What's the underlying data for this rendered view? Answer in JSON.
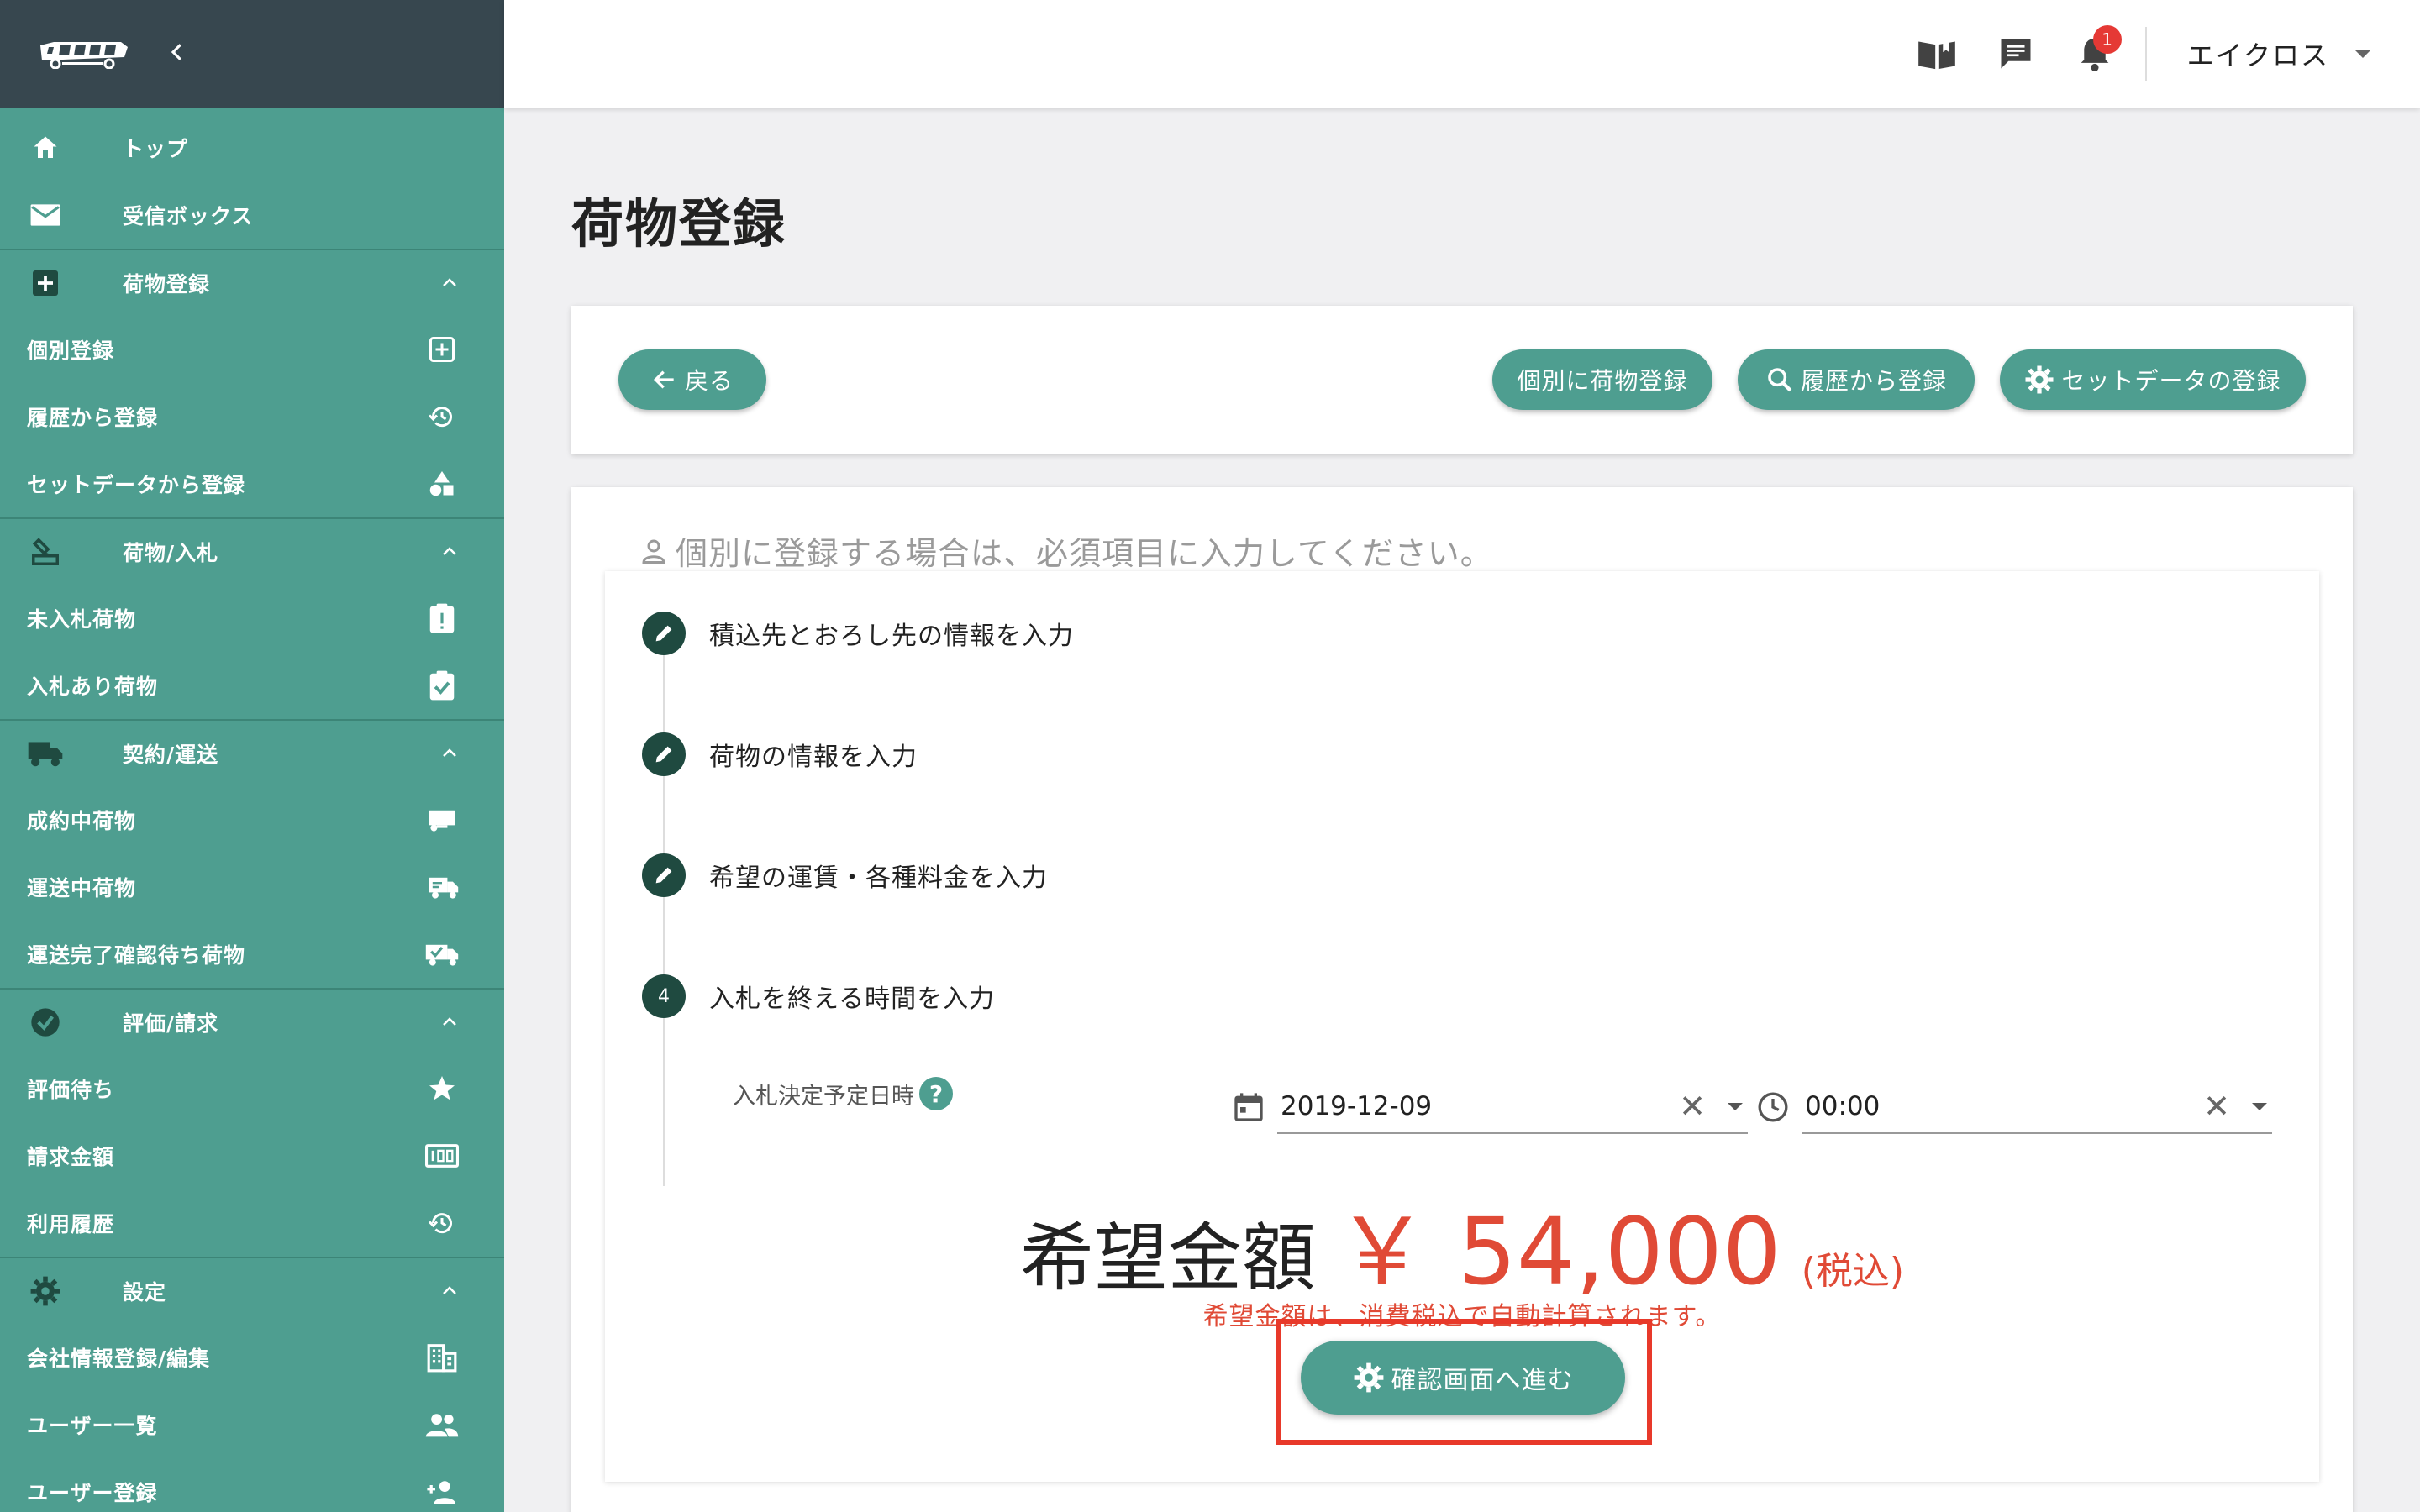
{
  "sidebar": {
    "items": {
      "top": "トップ",
      "inbox": "受信ボックス",
      "reg": "荷物登録",
      "reg_individual": "個別登録",
      "reg_history": "履歴から登録",
      "reg_set": "セットデータから登録",
      "bid": "荷物/入札",
      "bid_none": "未入札荷物",
      "bid_exists": "入札あり荷物",
      "contract": "契約/運送",
      "contract_active": "成約中荷物",
      "contract_transit": "運送中荷物",
      "contract_done": "運送完了確認待ち荷物",
      "eval": "評価/請求",
      "eval_wait": "評価待ち",
      "eval_amount": "請求金額",
      "eval_history": "利用履歴",
      "settings": "設定",
      "settings_company": "会社情報登録/編集",
      "settings_users": "ユーザー一覧",
      "settings_user_reg": "ユーザー登録"
    }
  },
  "topbar": {
    "notification_count": "1",
    "user_name": "エイクロス"
  },
  "page": {
    "title": "荷物登録"
  },
  "actions": {
    "back": "戻る",
    "individual": "個別に荷物登録",
    "history": "履歴から登録",
    "set": "セットデータの登録"
  },
  "form": {
    "hint": "個別に登録する場合は、必須項目に入力してください。",
    "steps": [
      {
        "marker": "",
        "label": "積込先とおろし先の情報を入力"
      },
      {
        "marker": "",
        "label": "荷物の情報を入力"
      },
      {
        "marker": "",
        "label": "希望の運賃・各種料金を入力"
      },
      {
        "marker": "4",
        "label": "入札を終える時間を入力"
      }
    ],
    "deadline_label": "入札決定予定日時",
    "help_mark": "?",
    "date_value": "2019-12-09",
    "time_value": "00:00",
    "clear_mark": "✕"
  },
  "price": {
    "label": "希望金額",
    "amount": "￥ 54,000",
    "tax": "(税込)",
    "note": "希望金額は、消費税込で自動計算されます。"
  },
  "confirm": {
    "label": "確認画面へ進む"
  },
  "colors": {
    "sidebar": "#4e9e90",
    "sidebar_header": "#37474f",
    "accent": "#4e9e90",
    "price": "#e04a36",
    "highlight": "#e8392a"
  }
}
